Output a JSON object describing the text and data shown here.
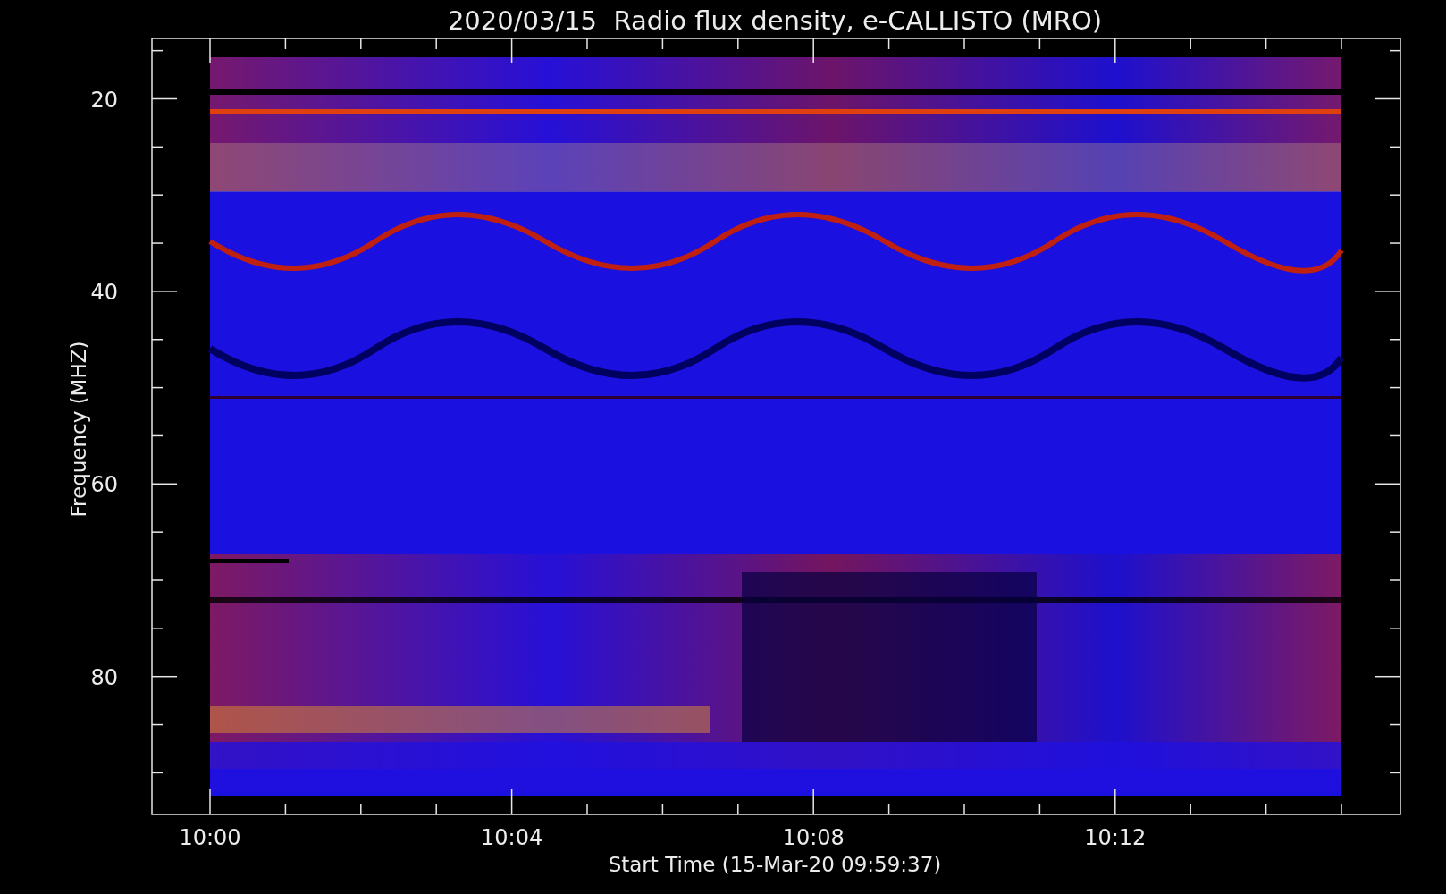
{
  "plot": {
    "title": "2020/03/15  Radio flux density, e-CALLISTO (MRO)",
    "ylabel": "Frequency (MHZ)",
    "xlabel": "Start Time (15-Mar-20 09:59:37)",
    "yticks": [
      "20",
      "40",
      "60",
      "80"
    ],
    "xticks": [
      "10:00",
      "10:04",
      "10:08",
      "10:12"
    ]
  }
}
